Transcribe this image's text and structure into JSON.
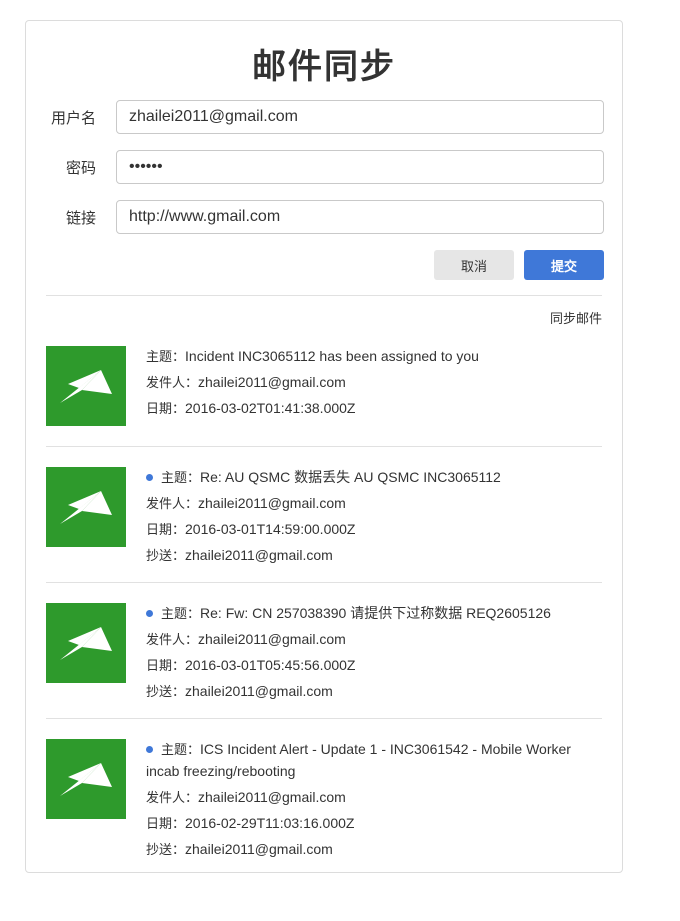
{
  "form": {
    "title": "邮件同步",
    "username_label": "用户名",
    "username_value": "zhailei2011@gmail.com",
    "password_label": "密码",
    "password_value": "••••••",
    "link_label": "链接",
    "link_value": "http://www.gmail.com",
    "cancel_label": "取消",
    "submit_label": "提交"
  },
  "sync_label": "同步邮件",
  "field_labels": {
    "subject": "主题：",
    "sender": "发件人：",
    "date": "日期：",
    "cc": "抄送："
  },
  "colors": {
    "accent": "#3f78d8",
    "thumbnail": "#2e9a2c"
  },
  "emails": [
    {
      "icon": "paper-plane-icon",
      "unread": false,
      "subject": "Incident INC3065112 has been assigned to you",
      "sender": "zhailei2011@gmail.com",
      "date": "2016-03-02T01:41:38.000Z"
    },
    {
      "icon": "paper-plane-icon",
      "unread": true,
      "subject": "Re: AU QSMC 数据丢失 AU QSMC INC3065112",
      "sender": "zhailei2011@gmail.com",
      "date": "2016-03-01T14:59:00.000Z",
      "cc": "zhailei2011@gmail.com"
    },
    {
      "icon": "paper-plane-icon",
      "unread": true,
      "subject": "Re: Fw: CN 257038390 请提供下过称数据 REQ2605126",
      "sender": "zhailei2011@gmail.com",
      "date": "2016-03-01T05:45:56.000Z",
      "cc": "zhailei2011@gmail.com"
    },
    {
      "icon": "paper-plane-icon",
      "unread": true,
      "subject": "ICS Incident Alert - Update 1 - INC3061542 - Mobile Worker incab freezing/rebooting",
      "sender": "zhailei2011@gmail.com",
      "date": "2016-02-29T11:03:16.000Z",
      "cc": "zhailei2011@gmail.com"
    }
  ]
}
